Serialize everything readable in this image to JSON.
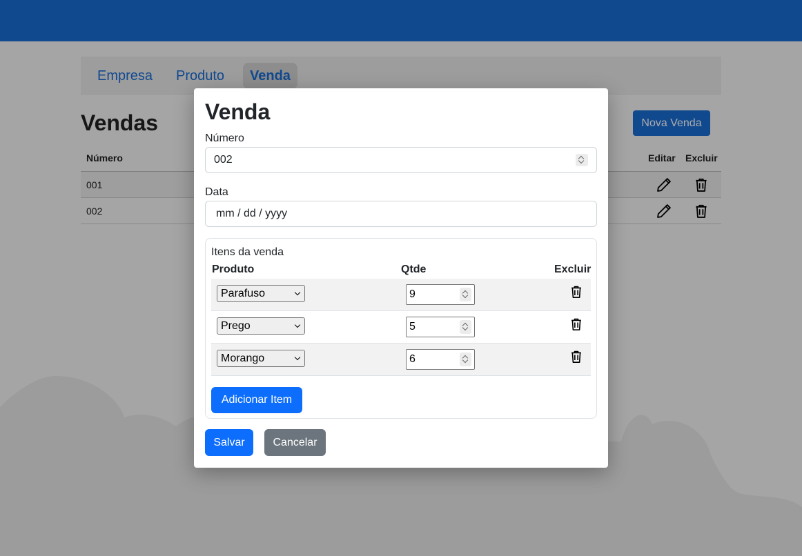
{
  "nav": {
    "items": [
      {
        "label": "Empresa"
      },
      {
        "label": "Produto"
      },
      {
        "label": "Venda",
        "active": true
      }
    ]
  },
  "page": {
    "title": "Vendas",
    "new_button": "Nova Venda"
  },
  "list": {
    "columns": {
      "numero": "Número",
      "editar": "Editar",
      "excluir": "Excluir"
    },
    "rows": [
      {
        "numero": "001"
      },
      {
        "numero": "002"
      }
    ]
  },
  "modal": {
    "title": "Venda",
    "numero_label": "Número",
    "numero_value": "002",
    "data_label": "Data",
    "data_placeholder": "mm / dd / yyyy",
    "items": {
      "title": "Itens da venda",
      "columns": {
        "produto": "Produto",
        "qtde": "Qtde",
        "excluir": "Excluir"
      },
      "rows": [
        {
          "produto": "Parafuso",
          "qtde": "9"
        },
        {
          "produto": "Prego",
          "qtde": "5"
        },
        {
          "produto": "Morango",
          "qtde": "6"
        }
      ],
      "add_button": "Adicionar Item"
    },
    "save_button": "Salvar",
    "cancel_button": "Cancelar"
  },
  "colors": {
    "header_blue": "#1a6dd6",
    "primary": "#0d6efd",
    "secondary": "#6c757d"
  }
}
